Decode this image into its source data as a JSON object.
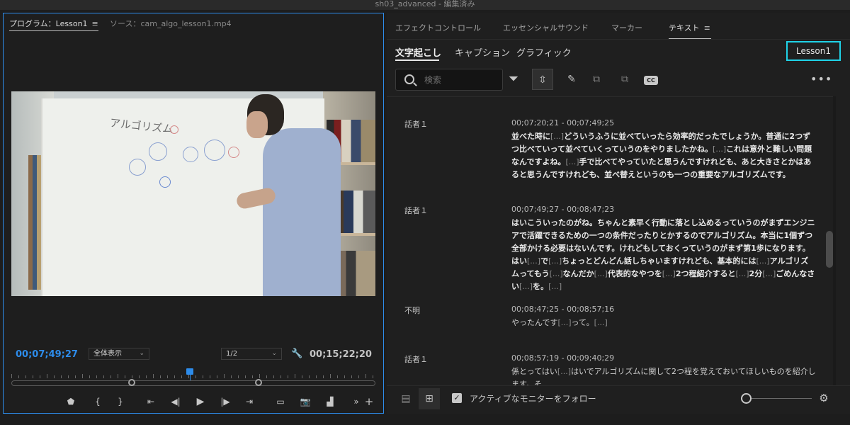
{
  "window": {
    "title": "sh03_advanced - 編集済み"
  },
  "program_monitor": {
    "tab_program": "プログラム：Lesson1",
    "tab_source": "ソース：cam_algo_lesson1.mp4",
    "video_whiteboard_text": "アルゴリズム",
    "current_timecode": "00;07;49;27",
    "zoom_select": "全体表示",
    "resolution_select": "1/2",
    "duration_timecode": "00;15;22;20",
    "playhead_position": 0.49
  },
  "essential_panel": {
    "tabs": [
      "エフェクトコントロール",
      "エッセンシャルサウンド",
      "マーカー",
      "テキスト"
    ],
    "active_tab": "テキスト",
    "subtabs": [
      "文字起こし",
      "キャプション",
      "グラフィック"
    ],
    "active_subtab": "文字起こし",
    "sequence_name": "Lesson1",
    "search_placeholder": "検索",
    "gap_marker": "[...]",
    "transcript": [
      {
        "speaker": "話者１",
        "timecode": "00;07;20;21 - 00;07;49;25",
        "text": "並べた時に[...]どういうふうに並べていったら効率的だったでしょうか。普通に2つずつ比べていって並べていくっていうのをやりましたかね。[...]これは意外と難しい問題なんですよね。[...]手で比べてやっていたと思うんですけれども、あと大きさとかはあると思うんですけれども、並べ替えというのも一つの重要なアルゴリズムです。"
      },
      {
        "speaker": "話者１",
        "timecode": "00;07;49;27 - 00;08;47;23",
        "text": "はいこういったのがね。ちゃんと素早く行動に落とし込めるっていうのがまずエンジニアで活躍できるための一つの条件だったりとかするのでアルゴリズム。本当に1個ずつ全部かける必要はないんです。けれどもしておくっていうのがまず第1歩になります。はい[...]で[...]ちょっとどんどん話しちゃいますけれども、基本的には[...]アルゴリズムってもう[...]なんだか[...]代表的なやつを[...]2つ程紹介すると[...]2分[...]ごめんなさい[...]を。[...]"
      },
      {
        "speaker": "不明",
        "timecode": "00;08;47;25 - 00;08;57;16",
        "text": "やったんです[...]って。[...]"
      },
      {
        "speaker": "話者１",
        "timecode": "00;08;57;19 - 00;09;40;29",
        "text": "係とってはい[...]はいでアルゴリズムに関して2つ程を覚えておいてほしいものを紹介します。そ"
      }
    ],
    "follow_monitor_label": "アクティブなモニターをフォロー",
    "follow_monitor_checked": true
  },
  "colors": {
    "accent_blue": "#2d8ceb",
    "highlight_cyan": "#1fd3e8",
    "panel_bg": "#1f1f1f"
  }
}
